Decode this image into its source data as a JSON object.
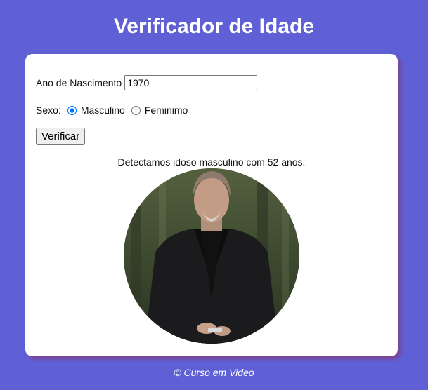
{
  "header": {
    "title": "Verificador de Idade"
  },
  "form": {
    "year_label": "Ano de Nascimento",
    "year_value": "1970",
    "sex_label": "Sexo:",
    "options": [
      {
        "label": "Masculino",
        "checked": true
      },
      {
        "label": "Feminimo",
        "checked": false
      }
    ],
    "verify_label": "Verificar"
  },
  "result": {
    "text": "Detectamos idoso masculino com 52 anos."
  },
  "footer": {
    "text": "© Curso em Video"
  },
  "colors": {
    "background": "#5f60d6",
    "card": "#ffffff",
    "radio_accent": "#0075ff"
  }
}
